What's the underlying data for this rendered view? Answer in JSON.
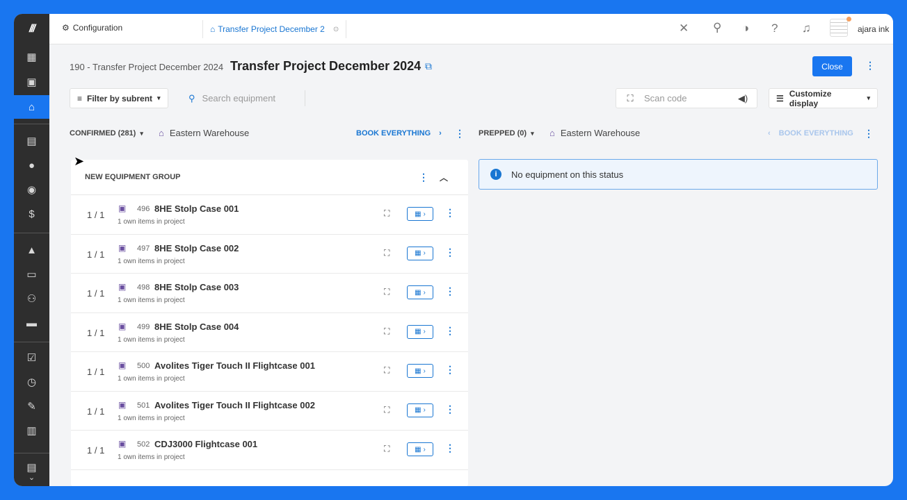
{
  "topbar": {
    "config_label": "Configuration",
    "project_tab_label": "Transfer Project December 2",
    "user_name": "ajara ink"
  },
  "header": {
    "breadcrumb": "190 - Transfer Project December 2024",
    "title": "Transfer Project December 2024",
    "close_label": "Close"
  },
  "toolbar": {
    "filter_label": "Filter by subrent",
    "search_placeholder": "Search equipment",
    "scan_placeholder": "Scan code",
    "customize_label": "Customize display"
  },
  "left_column": {
    "status_label": "CONFIRMED (281)",
    "warehouse": "Eastern Warehouse",
    "book_label": "BOOK EVERYTHING",
    "group_title": "NEW EQUIPMENT GROUP",
    "rows": [
      {
        "qty": "1 / 1",
        "num": "496",
        "name": "8HE Stolp Case 001",
        "sub": "1 own items in project"
      },
      {
        "qty": "1 / 1",
        "num": "497",
        "name": "8HE Stolp Case 002",
        "sub": "1 own items in project"
      },
      {
        "qty": "1 / 1",
        "num": "498",
        "name": "8HE Stolp Case 003",
        "sub": "1 own items in project"
      },
      {
        "qty": "1 / 1",
        "num": "499",
        "name": "8HE Stolp Case 004",
        "sub": "1 own items in project"
      },
      {
        "qty": "1 / 1",
        "num": "500",
        "name": "Avolites Tiger Touch II Flightcase 001",
        "sub": "1 own items in project"
      },
      {
        "qty": "1 / 1",
        "num": "501",
        "name": "Avolites Tiger Touch II Flightcase 002",
        "sub": "1 own items in project"
      },
      {
        "qty": "1 / 1",
        "num": "502",
        "name": "CDJ3000 Flightcase 001",
        "sub": "1 own items in project"
      }
    ]
  },
  "right_column": {
    "status_label": "PREPPED (0)",
    "warehouse": "Eastern Warehouse",
    "book_label": "BOOK EVERYTHING",
    "empty_message": "No equipment on this status"
  },
  "colors": {
    "accent": "#1976f0",
    "sidebar": "#2e2e2e",
    "link": "#1976d2"
  }
}
